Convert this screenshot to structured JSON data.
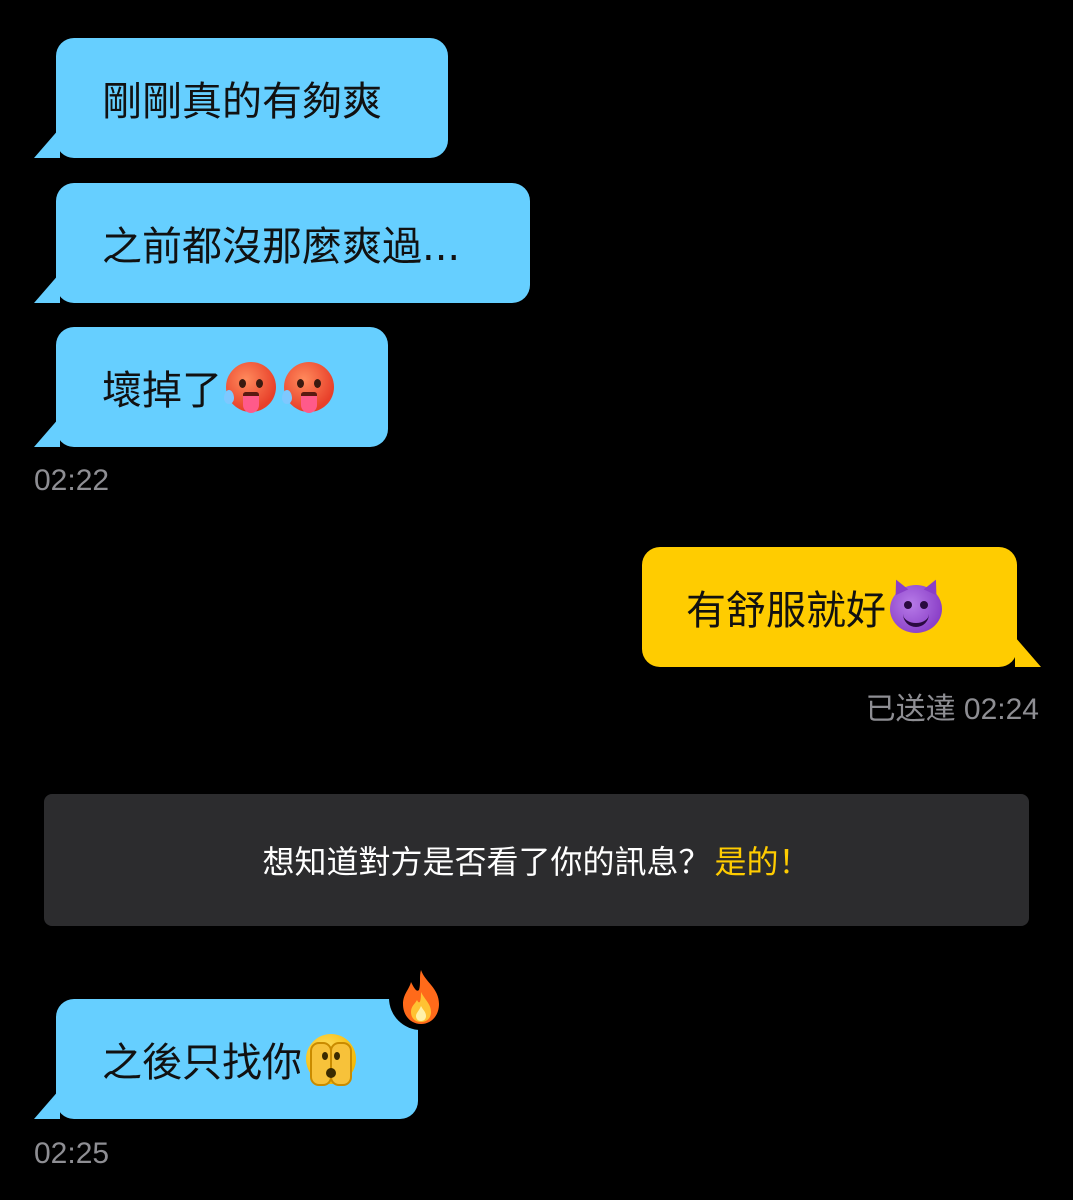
{
  "messages": [
    {
      "direction": "incoming",
      "text": "剛剛真的有夠爽"
    },
    {
      "direction": "incoming",
      "text": "之前都沒那麼爽過..."
    },
    {
      "direction": "incoming",
      "text": "壞掉了",
      "emoji": [
        "hot-face",
        "hot-face"
      ]
    },
    {
      "direction": "outgoing",
      "text": "有舒服就好 ",
      "emoji": [
        "smiling-devil-face"
      ]
    },
    {
      "direction": "incoming",
      "text": "之後只找你",
      "emoji": [
        "face-with-peeking-eye"
      ],
      "reaction": "fire"
    }
  ],
  "timestamps": {
    "first": "02:22",
    "delivered": "已送達 02:24",
    "last": "02:25"
  },
  "banner": {
    "question": "想知道對方是否看了你的訊息？",
    "answer": "是的！"
  },
  "colors": {
    "incoming_bubble": "#66cfff",
    "outgoing_bubble": "#ffcc00",
    "banner_bg": "#2c2c2e",
    "banner_accent": "#ffcc00",
    "timestamp": "#8e8e93",
    "background": "#000000"
  }
}
